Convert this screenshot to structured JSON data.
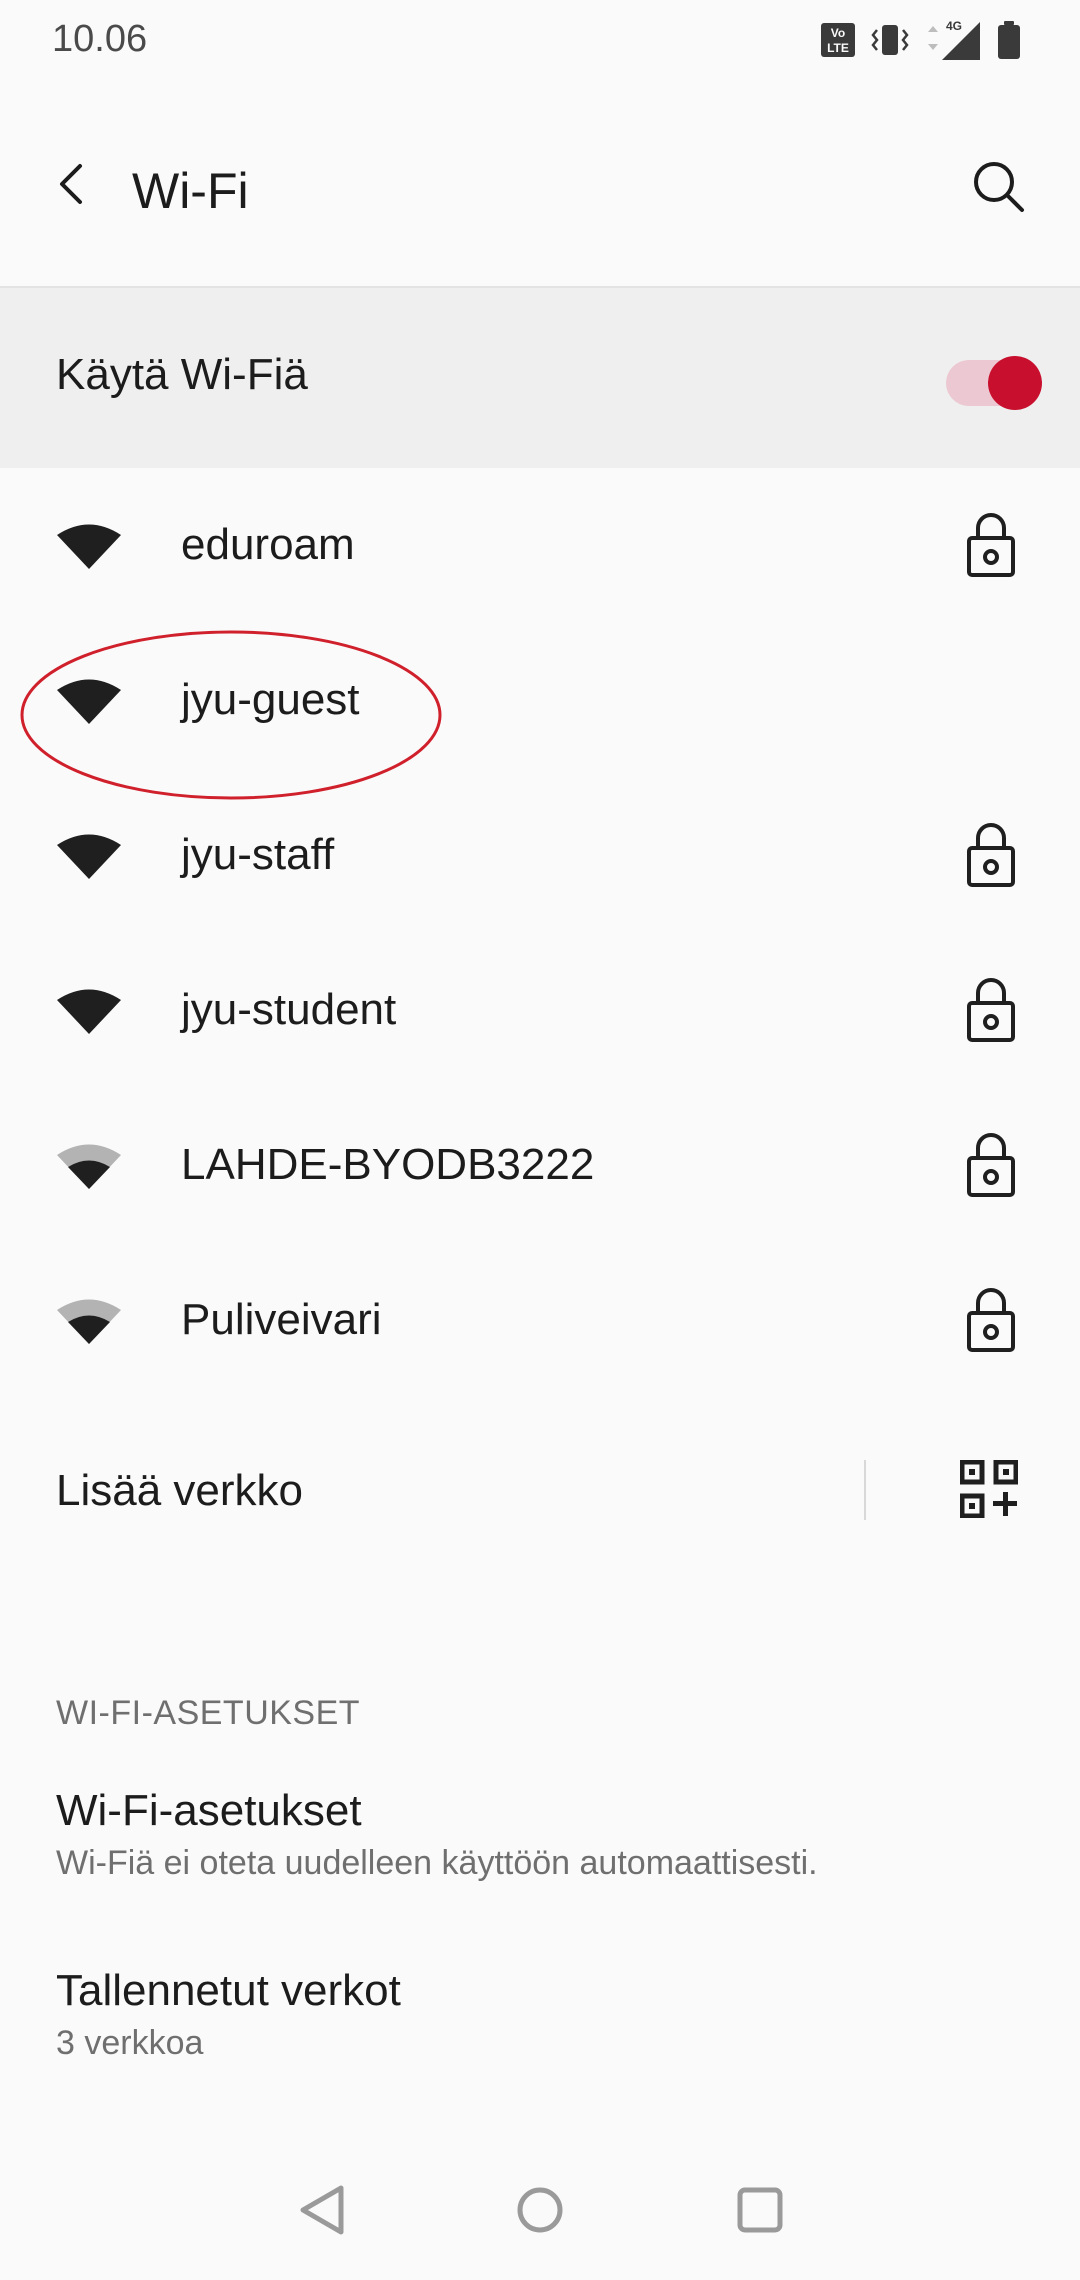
{
  "status_bar": {
    "time": "10.06",
    "network_type": "4G",
    "volte_label_top": "Vo",
    "volte_label_bottom": "LTE",
    "icons": [
      "volte-icon",
      "vibrate-icon",
      "signal-icon",
      "battery-icon"
    ]
  },
  "app_bar": {
    "title": "Wi-Fi",
    "back_icon": "chevron-left-icon",
    "search_icon": "search-icon"
  },
  "wifi_toggle": {
    "label": "Käytä Wi-Fiä",
    "enabled": true,
    "accent_color": "#c8102e"
  },
  "networks": [
    {
      "name": "eduroam",
      "secured": true,
      "signal": "full"
    },
    {
      "name": "jyu-guest",
      "secured": false,
      "signal": "full"
    },
    {
      "name": "jyu-staff",
      "secured": true,
      "signal": "full"
    },
    {
      "name": "jyu-student",
      "secured": true,
      "signal": "full"
    },
    {
      "name": "LAHDE-BYODB3222",
      "secured": true,
      "signal": "medium"
    },
    {
      "name": "Puliveivari",
      "secured": true,
      "signal": "medium"
    }
  ],
  "add_network": {
    "label": "Lisää verkko",
    "qr_icon": "qr-add-icon"
  },
  "settings_section": {
    "header": "WI-FI-ASETUKSET",
    "items": [
      {
        "title": "Wi-Fi-asetukset",
        "subtitle": "Wi-Fiä ei oteta uudelleen käyttöön automaattisesti."
      },
      {
        "title": "Tallennetut verkot",
        "subtitle": "3 verkkoa"
      }
    ]
  },
  "nav_bar": {
    "icons": [
      "back-triangle-icon",
      "home-circle-icon",
      "recents-square-icon"
    ]
  }
}
